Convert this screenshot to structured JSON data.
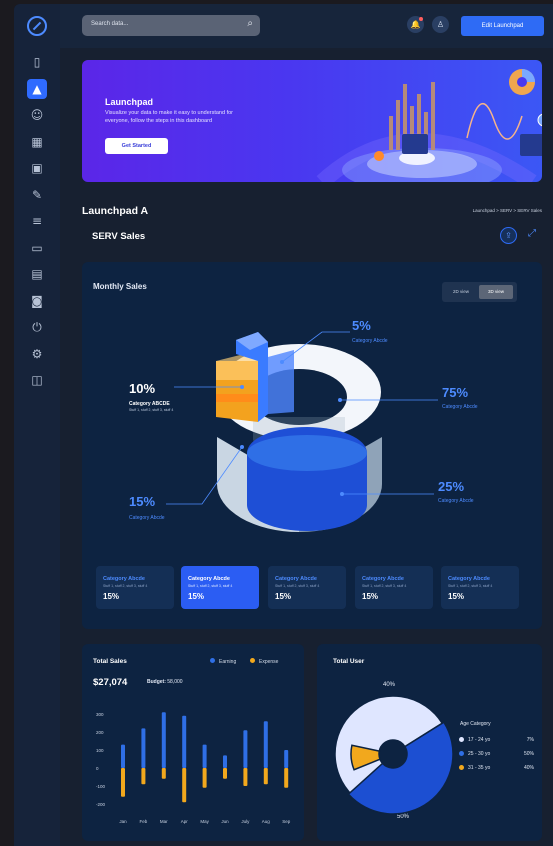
{
  "search": {
    "placeholder": "Search data..."
  },
  "header": {
    "edit_label": "Edit Launchpad"
  },
  "banner": {
    "title": "Launchpad",
    "description": "Visualize your data to make it easy to understand for everyone, follow the steps in this dashboard",
    "cta": "Get Started"
  },
  "page": {
    "title": "Launchpad A",
    "breadcrumb": "Launchpad  >  SERV  >  SERV Sales",
    "subtitle": "SERV Sales"
  },
  "monthly": {
    "title": "Monthly Sales",
    "view_2d": "2D view",
    "view_3d": "3D view",
    "callouts": [
      {
        "value": "5%",
        "label": "Category Abcde"
      },
      {
        "value": "10%",
        "label": "Category ABCDE",
        "sub": "Stuff 1, stuff 2, stuff 3, stuff 4"
      },
      {
        "value": "75%",
        "label": "Category Abcde"
      },
      {
        "value": "15%",
        "label": "Category Abcde"
      },
      {
        "value": "25%",
        "label": "Category Abcde"
      }
    ],
    "cards": [
      {
        "title": "Category Abcde",
        "sub": "Stuff 1, stuff 2, stuff 3, stuff 4",
        "value": "15%"
      },
      {
        "title": "Category Abcde",
        "sub": "Stuff 1, stuff 2, stuff 3, stuff 4",
        "value": "15%"
      },
      {
        "title": "Category Abcde",
        "sub": "Stuff 1, stuff 2, stuff 3, stuff 4",
        "value": "15%"
      },
      {
        "title": "Category Abcde",
        "sub": "Stuff 1, stuff 2, stuff 3, stuff 4",
        "value": "15%"
      },
      {
        "title": "Category Abcde",
        "sub": "Stuff 1, stuff 2, stuff 3, stuff 4",
        "value": "15%"
      }
    ]
  },
  "total_sales": {
    "title": "Total Sales",
    "legend_earning": "Earning",
    "legend_expense": "Expense",
    "amount": "$27,074",
    "budget_label": "Budget:",
    "budget_value": "58,000"
  },
  "total_user": {
    "title": "Total User",
    "age_category": "Age Category",
    "label_top": "40%",
    "label_bottom": "50%",
    "ages": [
      {
        "label": "17 - 24 yo",
        "pct": "7%"
      },
      {
        "label": "25 - 30 yo",
        "pct": "50%"
      },
      {
        "label": "31 - 35 yo",
        "pct": "40%"
      }
    ]
  },
  "colors": {
    "accent": "#2e6bf5",
    "earning": "#2f6fe6",
    "expense": "#f2a81d",
    "light": "#dfe6ff"
  },
  "icons": {
    "sidebar": [
      "logo-icon",
      "sidebar-home-icon",
      "sidebar-launchpad-icon",
      "sidebar-users-icon",
      "sidebar-table-icon",
      "sidebar-image-icon",
      "sidebar-edit-icon",
      "sidebar-audio-icon",
      "sidebar-monitor-icon",
      "sidebar-document-icon",
      "sidebar-camera-icon",
      "sidebar-power-icon",
      "sidebar-settings-icon",
      "sidebar-presentation-icon"
    ],
    "header": [
      "search-icon",
      "bell-icon",
      "user-icon"
    ]
  },
  "chart_data": [
    {
      "type": "pie",
      "title": "Monthly Sales",
      "labels": [
        "Category Abcde",
        "Category ABCDE",
        "Category Abcde",
        "Category Abcde",
        "Category Abcde"
      ],
      "values": [
        5,
        10,
        75,
        15,
        25
      ]
    },
    {
      "type": "bar",
      "title": "Total Sales",
      "categories": [
        "Jan",
        "Feb",
        "Mar",
        "Apr",
        "May",
        "Jun",
        "July",
        "Aug",
        "Sep"
      ],
      "series": [
        {
          "name": "Earning",
          "values": [
            130,
            220,
            310,
            290,
            130,
            70,
            210,
            260,
            100
          ]
        },
        {
          "name": "Expense",
          "values": [
            -160,
            -90,
            -60,
            -190,
            -110,
            -60,
            -100,
            -90,
            -110
          ]
        }
      ],
      "yticks": [
        300,
        200,
        100,
        0,
        -100,
        -200
      ],
      "ylim": [
        -200,
        300
      ]
    },
    {
      "type": "pie",
      "title": "Total User",
      "labels": [
        "17 - 24 yo",
        "25 - 30 yo",
        "31 - 35 yo"
      ],
      "values": [
        7,
        50,
        40
      ]
    }
  ]
}
